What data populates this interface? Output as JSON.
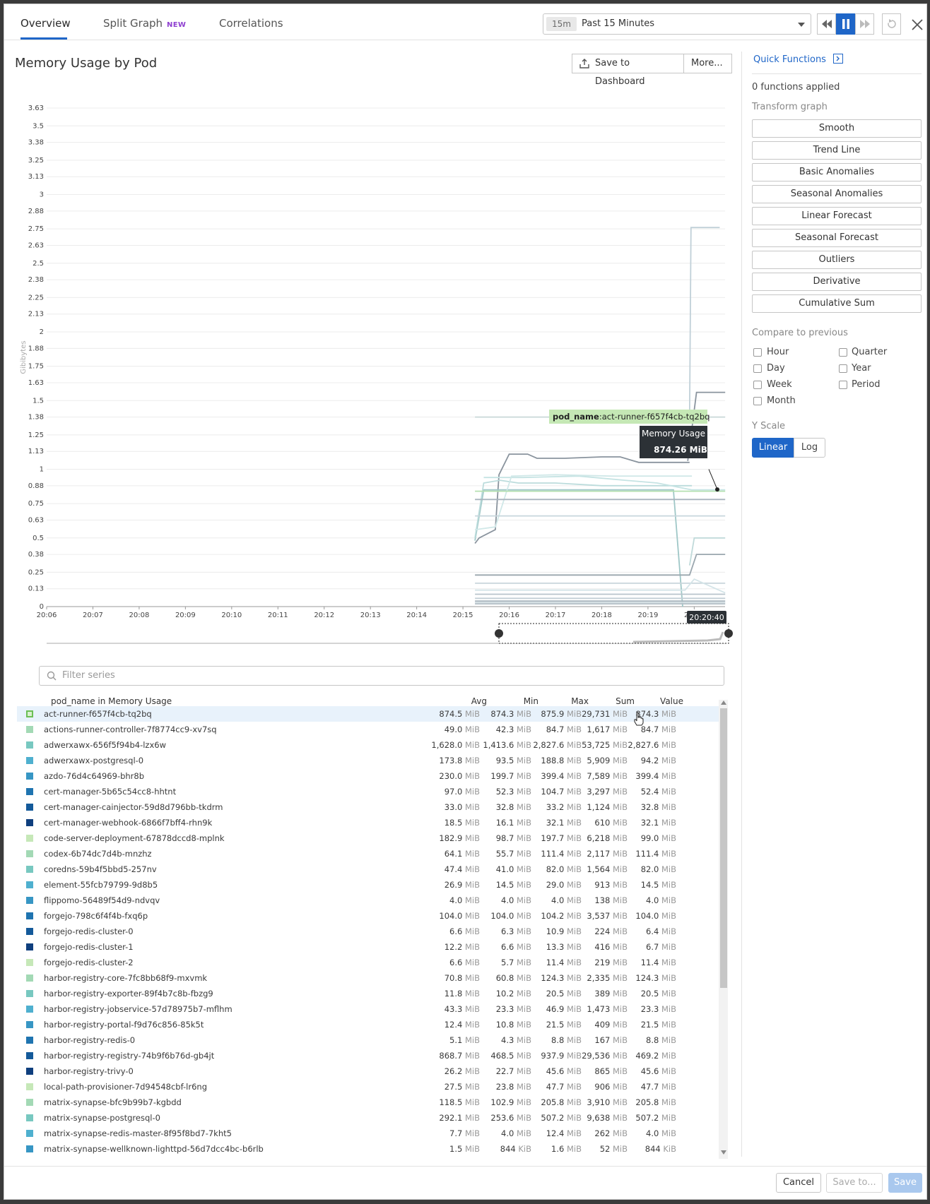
{
  "tabs": [
    {
      "label": "Overview",
      "active": true
    },
    {
      "label": "Split Graph",
      "badge": "NEW",
      "active": false
    },
    {
      "label": "Correlations",
      "active": false
    }
  ],
  "time": {
    "code": "15m",
    "label": "Past 15 Minutes"
  },
  "title": "Memory Usage by Pod",
  "toolbar": {
    "save_dashboard": "Save to Dashboard",
    "more": "More..."
  },
  "tooltip": {
    "key": "pod_name",
    "value": ":act-runner-f657f4cb-tq2bq",
    "metric": "Memory Usage",
    "reading": "874.26 MiB",
    "time": "20:20:40"
  },
  "chart_data": {
    "type": "line",
    "ylabel": "Gibibytes",
    "y_ticks": [
      "0",
      "0.13",
      "0.25",
      "0.38",
      "0.5",
      "0.63",
      "0.75",
      "0.88",
      "1",
      "1.13",
      "1.25",
      "1.38",
      "1.5",
      "1.63",
      "1.75",
      "1.88",
      "2",
      "2.13",
      "2.25",
      "2.38",
      "2.5",
      "2.63",
      "2.75",
      "2.88",
      "3",
      "3.13",
      "3.25",
      "3.38",
      "3.5",
      "3.63"
    ],
    "x_ticks": [
      "20:06",
      "20:07",
      "20:08",
      "20:09",
      "20:10",
      "20:11",
      "20:12",
      "20:13",
      "20:14",
      "20:15",
      "20:16",
      "20:17",
      "20:18",
      "20:19",
      "20:20"
    ],
    "ylim": [
      0,
      3.63
    ],
    "x_range": [
      "20:06",
      "20:20:40"
    ],
    "series": [
      {
        "color": "#c8d8d8",
        "points": [
          [
            15.26,
            1.38
          ],
          [
            20.67,
            1.38
          ]
        ]
      },
      {
        "color": "#c0d0d8",
        "points": [
          [
            19.9,
            1.38
          ],
          [
            19.93,
            2.76
          ],
          [
            20.55,
            2.76
          ]
        ]
      },
      {
        "color": "#8a949e",
        "points": [
          [
            19.86,
            1.06
          ],
          [
            20.05,
            1.56
          ],
          [
            20.67,
            1.56
          ]
        ]
      },
      {
        "color": "#8a949e",
        "points": [
          [
            15.26,
            0.46
          ],
          [
            15.35,
            0.5
          ],
          [
            15.7,
            0.56
          ],
          [
            15.78,
            0.96
          ],
          [
            16.0,
            1.11
          ],
          [
            16.4,
            1.11
          ],
          [
            16.6,
            1.08
          ],
          [
            17.2,
            1.08
          ],
          [
            18.0,
            1.09
          ],
          [
            18.4,
            1.09
          ],
          [
            18.8,
            1.05
          ],
          [
            19.3,
            1.05
          ],
          [
            19.9,
            1.05
          ]
        ]
      },
      {
        "color": "#9fc7c7",
        "points": [
          [
            15.26,
            0.48
          ],
          [
            15.45,
            0.85
          ],
          [
            16.4,
            0.85
          ],
          [
            19.0,
            0.85
          ],
          [
            19.55,
            0.85
          ],
          [
            19.75,
            0.0
          ]
        ]
      },
      {
        "color": "#bcdcdc",
        "points": [
          [
            15.26,
            0.5
          ],
          [
            15.45,
            0.9
          ],
          [
            15.8,
            0.92
          ],
          [
            16.2,
            0.9
          ],
          [
            17.0,
            0.9
          ],
          [
            18.0,
            0.88
          ],
          [
            19.3,
            0.88
          ],
          [
            19.5,
            0.88
          ],
          [
            19.95,
            0.88
          ]
        ]
      },
      {
        "color": "#c5e3e3",
        "points": [
          [
            15.45,
            0.94
          ],
          [
            16.3,
            0.94
          ],
          [
            17.5,
            0.95
          ],
          [
            18.5,
            0.92
          ],
          [
            19.2,
            0.9
          ],
          [
            19.95,
            0.85
          ],
          [
            20.67,
            0.85
          ]
        ]
      },
      {
        "color": "#d0e8e8",
        "points": [
          [
            15.26,
            0.56
          ],
          [
            15.7,
            0.58
          ],
          [
            16.05,
            0.95
          ],
          [
            17.0,
            0.96
          ],
          [
            18.2,
            0.95
          ],
          [
            19.1,
            0.95
          ],
          [
            19.95,
            0.95
          ]
        ]
      },
      {
        "color": "#b5e0b0",
        "points": [
          [
            15.26,
            0.84
          ],
          [
            20.67,
            0.84
          ]
        ]
      },
      {
        "color": "#a8b2bc",
        "points": [
          [
            15.26,
            0.78
          ],
          [
            20.67,
            0.78
          ]
        ]
      },
      {
        "color": "#c7d6dc",
        "points": [
          [
            15.26,
            0.66
          ],
          [
            20.67,
            0.66
          ]
        ]
      },
      {
        "color": "#c0dada",
        "points": [
          [
            19.9,
            0.3
          ],
          [
            20.0,
            0.5
          ],
          [
            20.67,
            0.5
          ]
        ]
      },
      {
        "color": "#9aa6ae",
        "points": [
          [
            15.26,
            0.23
          ],
          [
            19.9,
            0.23
          ],
          [
            20.05,
            0.38
          ],
          [
            20.67,
            0.38
          ]
        ]
      },
      {
        "color": "#c9d6dc",
        "points": [
          [
            15.26,
            0.17
          ],
          [
            20.67,
            0.17
          ]
        ]
      },
      {
        "color": "#d4e4e8",
        "points": [
          [
            15.26,
            0.12
          ],
          [
            19.8,
            0.12
          ],
          [
            20.0,
            0.2
          ],
          [
            20.67,
            0.1
          ]
        ]
      },
      {
        "color": "#b8c4cc",
        "points": [
          [
            15.26,
            0.09
          ],
          [
            20.67,
            0.09
          ]
        ]
      },
      {
        "color": "#c3cfd6",
        "points": [
          [
            15.26,
            0.06
          ],
          [
            20.67,
            0.06
          ]
        ]
      },
      {
        "color": "#a9b5bd",
        "points": [
          [
            15.26,
            0.04
          ],
          [
            20.67,
            0.04
          ]
        ]
      },
      {
        "color": "#d1dde2",
        "points": [
          [
            15.26,
            0.03
          ],
          [
            20.67,
            0.03
          ]
        ]
      },
      {
        "color": "#b0bcc4",
        "points": [
          [
            15.26,
            0.02
          ],
          [
            20.67,
            0.02
          ]
        ]
      }
    ]
  },
  "filter_placeholder": "Filter series",
  "table": {
    "headers": {
      "name": "pod_name in Memory Usage",
      "avg": "Avg",
      "min": "Min",
      "max": "Max",
      "sum": "Sum",
      "value": "Value"
    },
    "rows": [
      {
        "color": "#b5e0a8",
        "name": "act-runner-f657f4cb-tq2bq",
        "avg": "874.5",
        "avg_u": "MiB",
        "min": "874.3",
        "min_u": "MiB",
        "max": "875.9",
        "max_u": "MiB",
        "sum": "29,731",
        "sum_u": "MiB",
        "value": "874.3",
        "value_u": "MiB"
      },
      {
        "color": "#a3d9b5",
        "name": "actions-runner-controller-7f8774cc9-xv7sq",
        "avg": "49.0",
        "avg_u": "MiB",
        "min": "42.3",
        "min_u": "MiB",
        "max": "84.7",
        "max_u": "MiB",
        "sum": "1,617",
        "sum_u": "MiB",
        "value": "84.7",
        "value_u": "MiB"
      },
      {
        "color": "#78c8c0",
        "name": "adwerxawx-656f5f94b4-lzx6w",
        "avg": "1,628.0",
        "avg_u": "MiB",
        "min": "1,413.6",
        "min_u": "MiB",
        "max": "2,827.6",
        "max_u": "MiB",
        "sum": "53,725",
        "sum_u": "MiB",
        "value": "2,827.6",
        "value_u": "MiB"
      },
      {
        "color": "#4fb0cf",
        "name": "adwerxawx-postgresql-0",
        "avg": "173.8",
        "avg_u": "MiB",
        "min": "93.5",
        "min_u": "MiB",
        "max": "188.8",
        "max_u": "MiB",
        "sum": "5,909",
        "sum_u": "MiB",
        "value": "94.2",
        "value_u": "MiB"
      },
      {
        "color": "#3796c4",
        "name": "azdo-76d4c64969-bhr8b",
        "avg": "230.0",
        "avg_u": "MiB",
        "min": "199.7",
        "min_u": "MiB",
        "max": "399.4",
        "max_u": "MiB",
        "sum": "7,589",
        "sum_u": "MiB",
        "value": "399.4",
        "value_u": "MiB"
      },
      {
        "color": "#1f74b0",
        "name": "cert-manager-5b65c54cc8-hhtnt",
        "avg": "97.0",
        "avg_u": "MiB",
        "min": "52.3",
        "min_u": "MiB",
        "max": "104.7",
        "max_u": "MiB",
        "sum": "3,297",
        "sum_u": "MiB",
        "value": "52.4",
        "value_u": "MiB"
      },
      {
        "color": "#145a9a",
        "name": "cert-manager-cainjector-59d8d796bb-tkdrm",
        "avg": "33.0",
        "avg_u": "MiB",
        "min": "32.8",
        "min_u": "MiB",
        "max": "33.2",
        "max_u": "MiB",
        "sum": "1,124",
        "sum_u": "MiB",
        "value": "32.8",
        "value_u": "MiB"
      },
      {
        "color": "#0f3f7e",
        "name": "cert-manager-webhook-6866f7bff4-rhn9k",
        "avg": "18.5",
        "avg_u": "MiB",
        "min": "16.1",
        "min_u": "MiB",
        "max": "32.1",
        "max_u": "MiB",
        "sum": "610",
        "sum_u": "MiB",
        "value": "32.1",
        "value_u": "MiB"
      },
      {
        "color": "#c6e8b8",
        "name": "code-server-deployment-67878dccd8-mplnk",
        "avg": "182.9",
        "avg_u": "MiB",
        "min": "98.7",
        "min_u": "MiB",
        "max": "197.7",
        "max_u": "MiB",
        "sum": "6,218",
        "sum_u": "MiB",
        "value": "99.0",
        "value_u": "MiB"
      },
      {
        "color": "#a3d9b5",
        "name": "codex-6b74dc7d4b-mnzhz",
        "avg": "64.1",
        "avg_u": "MiB",
        "min": "55.7",
        "min_u": "MiB",
        "max": "111.4",
        "max_u": "MiB",
        "sum": "2,117",
        "sum_u": "MiB",
        "value": "111.4",
        "value_u": "MiB"
      },
      {
        "color": "#78c8c0",
        "name": "coredns-59b4f5bbd5-257nv",
        "avg": "47.4",
        "avg_u": "MiB",
        "min": "41.0",
        "min_u": "MiB",
        "max": "82.0",
        "max_u": "MiB",
        "sum": "1,564",
        "sum_u": "MiB",
        "value": "82.0",
        "value_u": "MiB"
      },
      {
        "color": "#4fb0cf",
        "name": "element-55fcb79799-9d8b5",
        "avg": "26.9",
        "avg_u": "MiB",
        "min": "14.5",
        "min_u": "MiB",
        "max": "29.0",
        "max_u": "MiB",
        "sum": "913",
        "sum_u": "MiB",
        "value": "14.5",
        "value_u": "MiB"
      },
      {
        "color": "#3796c4",
        "name": "flippomo-56489f54d9-ndvqv",
        "avg": "4.0",
        "avg_u": "MiB",
        "min": "4.0",
        "min_u": "MiB",
        "max": "4.0",
        "max_u": "MiB",
        "sum": "138",
        "sum_u": "MiB",
        "value": "4.0",
        "value_u": "MiB"
      },
      {
        "color": "#1f74b0",
        "name": "forgejo-798c6f4f4b-fxq6p",
        "avg": "104.0",
        "avg_u": "MiB",
        "min": "104.0",
        "min_u": "MiB",
        "max": "104.2",
        "max_u": "MiB",
        "sum": "3,537",
        "sum_u": "MiB",
        "value": "104.0",
        "value_u": "MiB"
      },
      {
        "color": "#145a9a",
        "name": "forgejo-redis-cluster-0",
        "avg": "6.6",
        "avg_u": "MiB",
        "min": "6.3",
        "min_u": "MiB",
        "max": "10.9",
        "max_u": "MiB",
        "sum": "224",
        "sum_u": "MiB",
        "value": "6.4",
        "value_u": "MiB"
      },
      {
        "color": "#0f3f7e",
        "name": "forgejo-redis-cluster-1",
        "avg": "12.2",
        "avg_u": "MiB",
        "min": "6.6",
        "min_u": "MiB",
        "max": "13.3",
        "max_u": "MiB",
        "sum": "416",
        "sum_u": "MiB",
        "value": "6.7",
        "value_u": "MiB"
      },
      {
        "color": "#c6e8b8",
        "name": "forgejo-redis-cluster-2",
        "avg": "6.6",
        "avg_u": "MiB",
        "min": "5.7",
        "min_u": "MiB",
        "max": "11.4",
        "max_u": "MiB",
        "sum": "219",
        "sum_u": "MiB",
        "value": "11.4",
        "value_u": "MiB"
      },
      {
        "color": "#a3d9b5",
        "name": "harbor-registry-core-7fc8bb68f9-mxvmk",
        "avg": "70.8",
        "avg_u": "MiB",
        "min": "60.8",
        "min_u": "MiB",
        "max": "124.3",
        "max_u": "MiB",
        "sum": "2,335",
        "sum_u": "MiB",
        "value": "124.3",
        "value_u": "MiB"
      },
      {
        "color": "#78c8c0",
        "name": "harbor-registry-exporter-89f4b7c8b-fbzg9",
        "avg": "11.8",
        "avg_u": "MiB",
        "min": "10.2",
        "min_u": "MiB",
        "max": "20.5",
        "max_u": "MiB",
        "sum": "389",
        "sum_u": "MiB",
        "value": "20.5",
        "value_u": "MiB"
      },
      {
        "color": "#4fb0cf",
        "name": "harbor-registry-jobservice-57d78975b7-mflhm",
        "avg": "43.3",
        "avg_u": "MiB",
        "min": "23.3",
        "min_u": "MiB",
        "max": "46.9",
        "max_u": "MiB",
        "sum": "1,473",
        "sum_u": "MiB",
        "value": "23.3",
        "value_u": "MiB"
      },
      {
        "color": "#3796c4",
        "name": "harbor-registry-portal-f9d76c856-85k5t",
        "avg": "12.4",
        "avg_u": "MiB",
        "min": "10.8",
        "min_u": "MiB",
        "max": "21.5",
        "max_u": "MiB",
        "sum": "409",
        "sum_u": "MiB",
        "value": "21.5",
        "value_u": "MiB"
      },
      {
        "color": "#1f74b0",
        "name": "harbor-registry-redis-0",
        "avg": "5.1",
        "avg_u": "MiB",
        "min": "4.3",
        "min_u": "MiB",
        "max": "8.8",
        "max_u": "MiB",
        "sum": "167",
        "sum_u": "MiB",
        "value": "8.8",
        "value_u": "MiB"
      },
      {
        "color": "#145a9a",
        "name": "harbor-registry-registry-74b9f6b76d-gb4jt",
        "avg": "868.7",
        "avg_u": "MiB",
        "min": "468.5",
        "min_u": "MiB",
        "max": "937.9",
        "max_u": "MiB",
        "sum": "29,536",
        "sum_u": "MiB",
        "value": "469.2",
        "value_u": "MiB"
      },
      {
        "color": "#0f3f7e",
        "name": "harbor-registry-trivy-0",
        "avg": "26.2",
        "avg_u": "MiB",
        "min": "22.7",
        "min_u": "MiB",
        "max": "45.6",
        "max_u": "MiB",
        "sum": "865",
        "sum_u": "MiB",
        "value": "45.6",
        "value_u": "MiB"
      },
      {
        "color": "#c6e8b8",
        "name": "local-path-provisioner-7d94548cbf-lr6ng",
        "avg": "27.5",
        "avg_u": "MiB",
        "min": "23.8",
        "min_u": "MiB",
        "max": "47.7",
        "max_u": "MiB",
        "sum": "906",
        "sum_u": "MiB",
        "value": "47.7",
        "value_u": "MiB"
      },
      {
        "color": "#a3d9b5",
        "name": "matrix-synapse-bfc9b99b7-kgbdd",
        "avg": "118.5",
        "avg_u": "MiB",
        "min": "102.9",
        "min_u": "MiB",
        "max": "205.8",
        "max_u": "MiB",
        "sum": "3,910",
        "sum_u": "MiB",
        "value": "205.8",
        "value_u": "MiB"
      },
      {
        "color": "#78c8c0",
        "name": "matrix-synapse-postgresql-0",
        "avg": "292.1",
        "avg_u": "MiB",
        "min": "253.6",
        "min_u": "MiB",
        "max": "507.2",
        "max_u": "MiB",
        "sum": "9,638",
        "sum_u": "MiB",
        "value": "507.2",
        "value_u": "MiB"
      },
      {
        "color": "#4fb0cf",
        "name": "matrix-synapse-redis-master-8f95f8bd7-7kht5",
        "avg": "7.7",
        "avg_u": "MiB",
        "min": "4.0",
        "min_u": "MiB",
        "max": "12.4",
        "max_u": "MiB",
        "sum": "262",
        "sum_u": "MiB",
        "value": "4.0",
        "value_u": "MiB"
      },
      {
        "color": "#3796c4",
        "name": "matrix-synapse-wellknown-lighttpd-56d7dcc4bc-b6rlb",
        "avg": "1.5",
        "avg_u": "MiB",
        "min": "844",
        "min_u": "KiB",
        "max": "1.6",
        "max_u": "MiB",
        "sum": "52",
        "sum_u": "MiB",
        "value": "844",
        "value_u": "KiB"
      }
    ]
  },
  "panel": {
    "quick_functions": "Quick Functions",
    "applied": "0 functions applied",
    "transform": "Transform graph",
    "functions": [
      "Smooth",
      "Trend Line",
      "Basic Anomalies",
      "Seasonal Anomalies",
      "Linear Forecast",
      "Seasonal Forecast",
      "Outliers",
      "Derivative",
      "Cumulative Sum"
    ],
    "compare": "Compare to previous",
    "compare_left": [
      "Hour",
      "Day",
      "Week",
      "Month"
    ],
    "compare_right": [
      "Quarter",
      "Year",
      "Period"
    ],
    "yscale": "Y Scale",
    "yscale_options": [
      "Linear",
      "Log"
    ]
  },
  "footer": {
    "cancel": "Cancel",
    "save_to": "Save to...",
    "save": "Save"
  },
  "colors": {
    "accent": "#1f66c8",
    "badge": "#8e3fd0",
    "tooltip_green": "#c5e8b5",
    "tooltip_dark": "#2c3136"
  }
}
